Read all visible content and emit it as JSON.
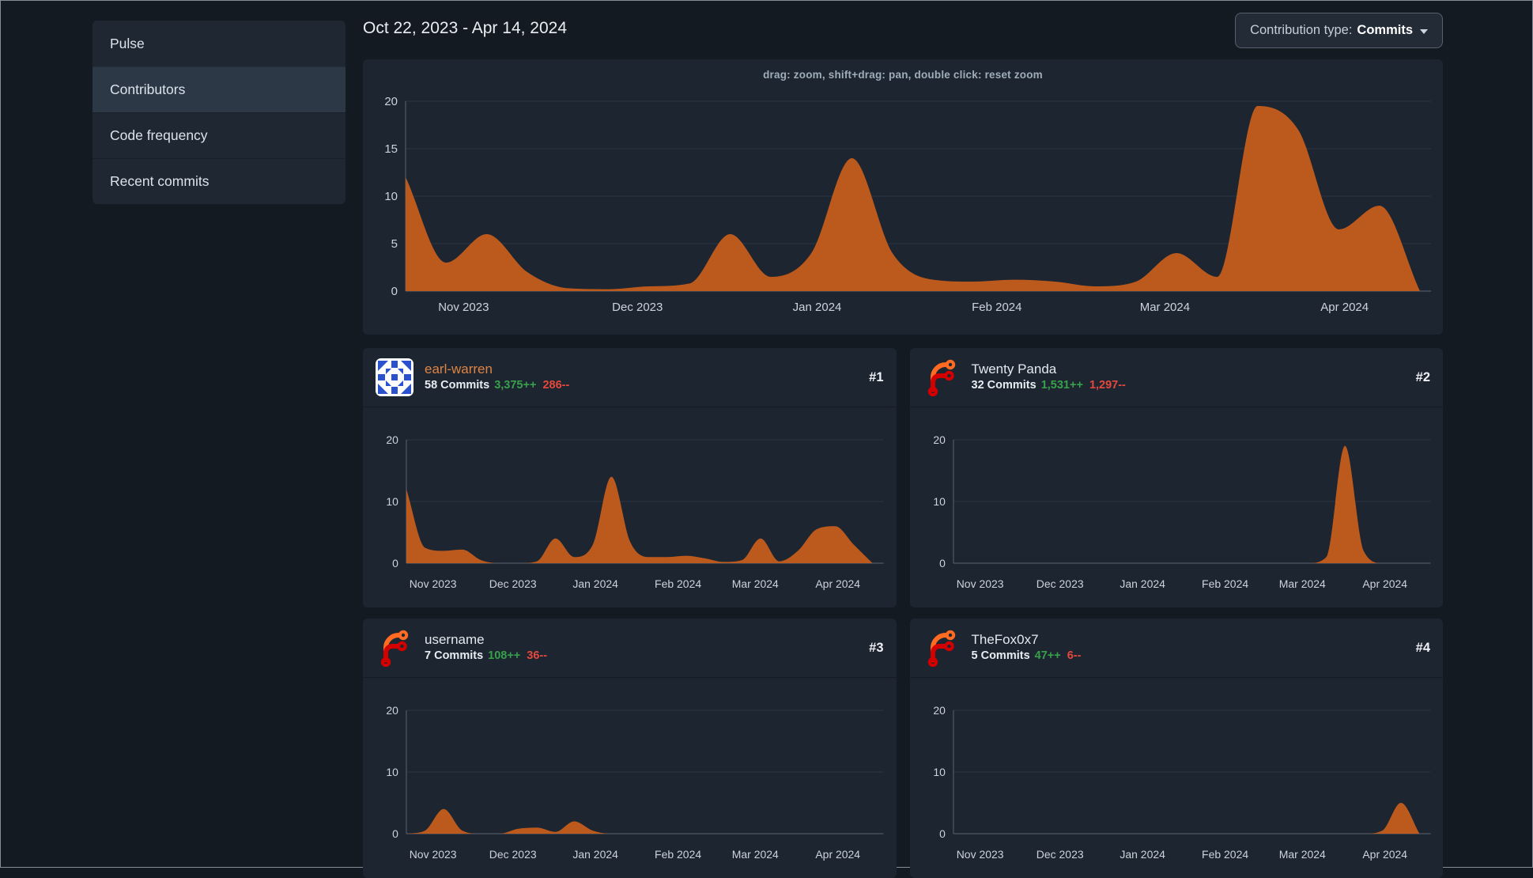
{
  "page": {
    "bg": "#141a22",
    "card_bg": "#1d2530",
    "accent_orange": "#bc5a1e",
    "green": "#37a04b",
    "red": "#e5483c"
  },
  "sidebar": {
    "items": [
      {
        "label": "Pulse",
        "active": false
      },
      {
        "label": "Contributors",
        "active": true
      },
      {
        "label": "Code frequency",
        "active": false
      },
      {
        "label": "Recent commits",
        "active": false
      }
    ]
  },
  "header": {
    "date_range": "Oct 22, 2023 - Apr 14, 2024",
    "contribution_type_label": "Contribution type:",
    "contribution_type_value": "Commits"
  },
  "main_chart": {
    "hint": "drag: zoom, shift+drag: pan, double click: reset zoom"
  },
  "contributors": [
    {
      "rank": "#1",
      "name": "earl-warren",
      "name_color": "#dd8443",
      "commits": "58 Commits",
      "additions": "3,375++",
      "deletions": "286--",
      "avatar": "identicon",
      "avatar_colors": {
        "bg": "#ffffff",
        "fg": "#2b52cc"
      }
    },
    {
      "rank": "#2",
      "name": "Twenty Panda",
      "name_color": "#e4e9ef",
      "commits": "32 Commits",
      "additions": "1,531++",
      "deletions": "1,297--",
      "avatar": "forgejo-logo",
      "avatar_colors": {
        "orange": "#ff6b22",
        "red": "#d40000"
      }
    },
    {
      "rank": "#3",
      "name": "username",
      "name_color": "#e4e9ef",
      "commits": "7 Commits",
      "additions": "108++",
      "deletions": "36--",
      "avatar": "forgejo-logo",
      "avatar_colors": {
        "orange": "#ff6b22",
        "red": "#d40000"
      }
    },
    {
      "rank": "#4",
      "name": "TheFox0x7",
      "name_color": "#e4e9ef",
      "commits": "5 Commits",
      "additions": "47++",
      "deletions": "6--",
      "avatar": "forgejo-logo",
      "avatar_colors": {
        "orange": "#ff6b22",
        "red": "#d40000"
      }
    }
  ],
  "chart_data": [
    {
      "id": "overall",
      "type": "area",
      "title": "Commits per week — all contributors",
      "color": "#bc5a1e",
      "x_unit": "week",
      "x_start": "Oct 22, 2023",
      "x_end": "Apr 14, 2024",
      "total_days": 175,
      "month_ticks": [
        "Nov 2023",
        "Dec 2023",
        "Jan 2024",
        "Feb 2024",
        "Mar 2024",
        "Apr 2024"
      ],
      "month_days": [
        10,
        40,
        71,
        102,
        131,
        162
      ],
      "y_ticks": [
        0,
        5,
        10,
        15,
        20
      ],
      "ylim": [
        0,
        20
      ],
      "grid": true,
      "legend": "none",
      "values": [
        12,
        3,
        6,
        2,
        0.3,
        0.2,
        0.5,
        0.8,
        6,
        1.5,
        4,
        14,
        4,
        1.2,
        1,
        1.2,
        1,
        0.5,
        1,
        4,
        1.5,
        19.5,
        17,
        6.5,
        9,
        0
      ]
    },
    {
      "id": "earl-warren",
      "type": "area",
      "title": "earl-warren commits per week",
      "color": "#bc5a1e",
      "x_unit": "week",
      "x_start": "Oct 22, 2023",
      "x_end": "Apr 14, 2024",
      "total_days": 175,
      "month_ticks": [
        "Nov 2023",
        "Dec 2023",
        "Jan 2024",
        "Feb 2024",
        "Mar 2024",
        "Apr 2024"
      ],
      "month_days": [
        10,
        40,
        71,
        102,
        131,
        162
      ],
      "y_ticks": [
        0,
        10,
        20
      ],
      "ylim": [
        0,
        20
      ],
      "grid": true,
      "legend": "none",
      "values": [
        12,
        2.5,
        2,
        2.2,
        0.5,
        0,
        0,
        0.3,
        4,
        1,
        3,
        14,
        3.5,
        1,
        1,
        1.2,
        0.8,
        0.2,
        0.5,
        4,
        0.3,
        2,
        5.5,
        6,
        3,
        0
      ]
    },
    {
      "id": "twenty-panda",
      "type": "area",
      "title": "Twenty Panda commits per week",
      "color": "#bc5a1e",
      "x_unit": "week",
      "x_start": "Oct 22, 2023",
      "x_end": "Apr 14, 2024",
      "total_days": 175,
      "month_ticks": [
        "Nov 2023",
        "Dec 2023",
        "Jan 2024",
        "Feb 2024",
        "Mar 2024",
        "Apr 2024"
      ],
      "month_days": [
        10,
        40,
        71,
        102,
        131,
        162
      ],
      "y_ticks": [
        0,
        10,
        20
      ],
      "ylim": [
        0,
        20
      ],
      "grid": true,
      "legend": "none",
      "values": [
        0,
        0,
        0,
        0,
        0,
        0,
        0,
        0,
        0,
        0,
        0,
        0,
        0,
        0,
        0,
        0,
        0,
        0,
        0,
        0,
        1,
        19,
        2,
        0,
        0,
        0
      ]
    },
    {
      "id": "username",
      "type": "area",
      "title": "username commits per week",
      "color": "#bc5a1e",
      "x_unit": "week",
      "x_start": "Oct 22, 2023",
      "x_end": "Apr 14, 2024",
      "total_days": 175,
      "month_ticks": [
        "Nov 2023",
        "Dec 2023",
        "Jan 2024",
        "Feb 2024",
        "Mar 2024",
        "Apr 2024"
      ],
      "month_days": [
        10,
        40,
        71,
        102,
        131,
        162
      ],
      "y_ticks": [
        0,
        10,
        20
      ],
      "ylim": [
        0,
        20
      ],
      "grid": true,
      "legend": "none",
      "values": [
        0,
        0.5,
        4,
        0.5,
        0,
        0,
        0.8,
        1,
        0.3,
        2,
        0.5,
        0,
        0,
        0,
        0,
        0,
        0,
        0,
        0,
        0,
        0,
        0,
        0,
        0,
        0,
        0
      ]
    },
    {
      "id": "thefox0x7",
      "type": "area",
      "title": "TheFox0x7 commits per week",
      "color": "#bc5a1e",
      "x_unit": "week",
      "x_start": "Oct 22, 2023",
      "x_end": "Apr 14, 2024",
      "total_days": 175,
      "month_ticks": [
        "Nov 2023",
        "Dec 2023",
        "Jan 2024",
        "Feb 2024",
        "Mar 2024",
        "Apr 2024"
      ],
      "month_days": [
        10,
        40,
        71,
        102,
        131,
        162
      ],
      "y_ticks": [
        0,
        10,
        20
      ],
      "ylim": [
        0,
        20
      ],
      "grid": true,
      "legend": "none",
      "values": [
        0,
        0,
        0,
        0,
        0,
        0,
        0,
        0,
        0,
        0,
        0,
        0,
        0,
        0,
        0,
        0,
        0,
        0,
        0,
        0,
        0,
        0,
        0,
        0.5,
        5,
        0
      ]
    }
  ]
}
